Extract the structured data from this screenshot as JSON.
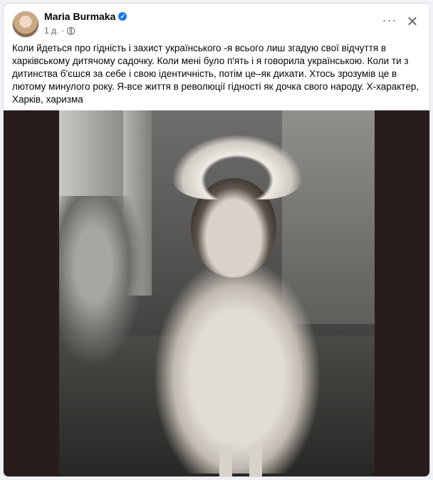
{
  "post": {
    "author": "Maria Burmaka",
    "verified": true,
    "time": "1 д.",
    "privacy_icon": "globe-icon",
    "more_icon": "···",
    "close_icon": "✕",
    "text": "Коли йдеться про гідність і захист українського -я всього лиш згадую свої відчуття в харківському дитячому садочку. Коли мені було п'ять і я говорила українською. Коли ти з дитинства б'єшся за себе і свою ідентичність, потім це–як дихати. Хтось зрозумів це в лютому минулого року. Я-все життя в революції гідності як дочка свого народу. Х-характер, Харків, харизма"
  },
  "colors": {
    "accent": "#1877f2",
    "text": "#050505",
    "muted": "#65676b",
    "photo_bg": "#291c1c"
  }
}
